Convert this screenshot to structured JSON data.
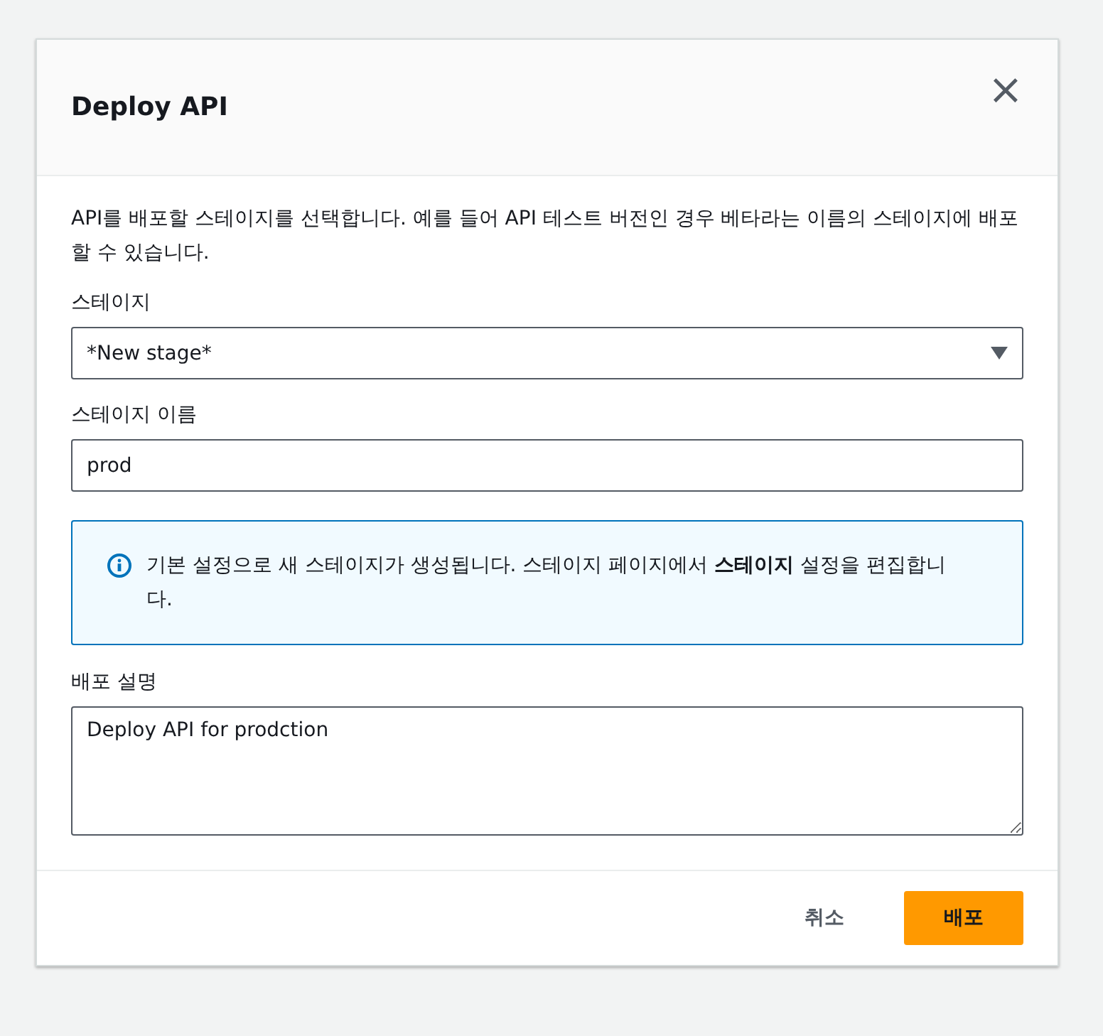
{
  "dialog": {
    "title": "Deploy API",
    "close": "×",
    "intro": "API를 배포할 스테이지를 선택합니다. 예를 들어 API 테스트 버전인 경우 베타라는 이름의 스테이지에 배포할 수 있습니다.",
    "stage": {
      "label": "스테이지",
      "value": "*New stage*"
    },
    "stage_name": {
      "label": "스테이지 이름",
      "value": "prod"
    },
    "info": "기본 설정으로 새 스테이지가 생성됩니다. 스테이지 페이지에서 **스테이지** 설정을 편집합니다.",
    "description": {
      "label": "배포 설명",
      "value": "Deploy API for prodction"
    },
    "buttons": [
      {
        "label": "취소",
        "kind": "link"
      },
      {
        "label": "배포",
        "kind": "primary"
      }
    ]
  }
}
